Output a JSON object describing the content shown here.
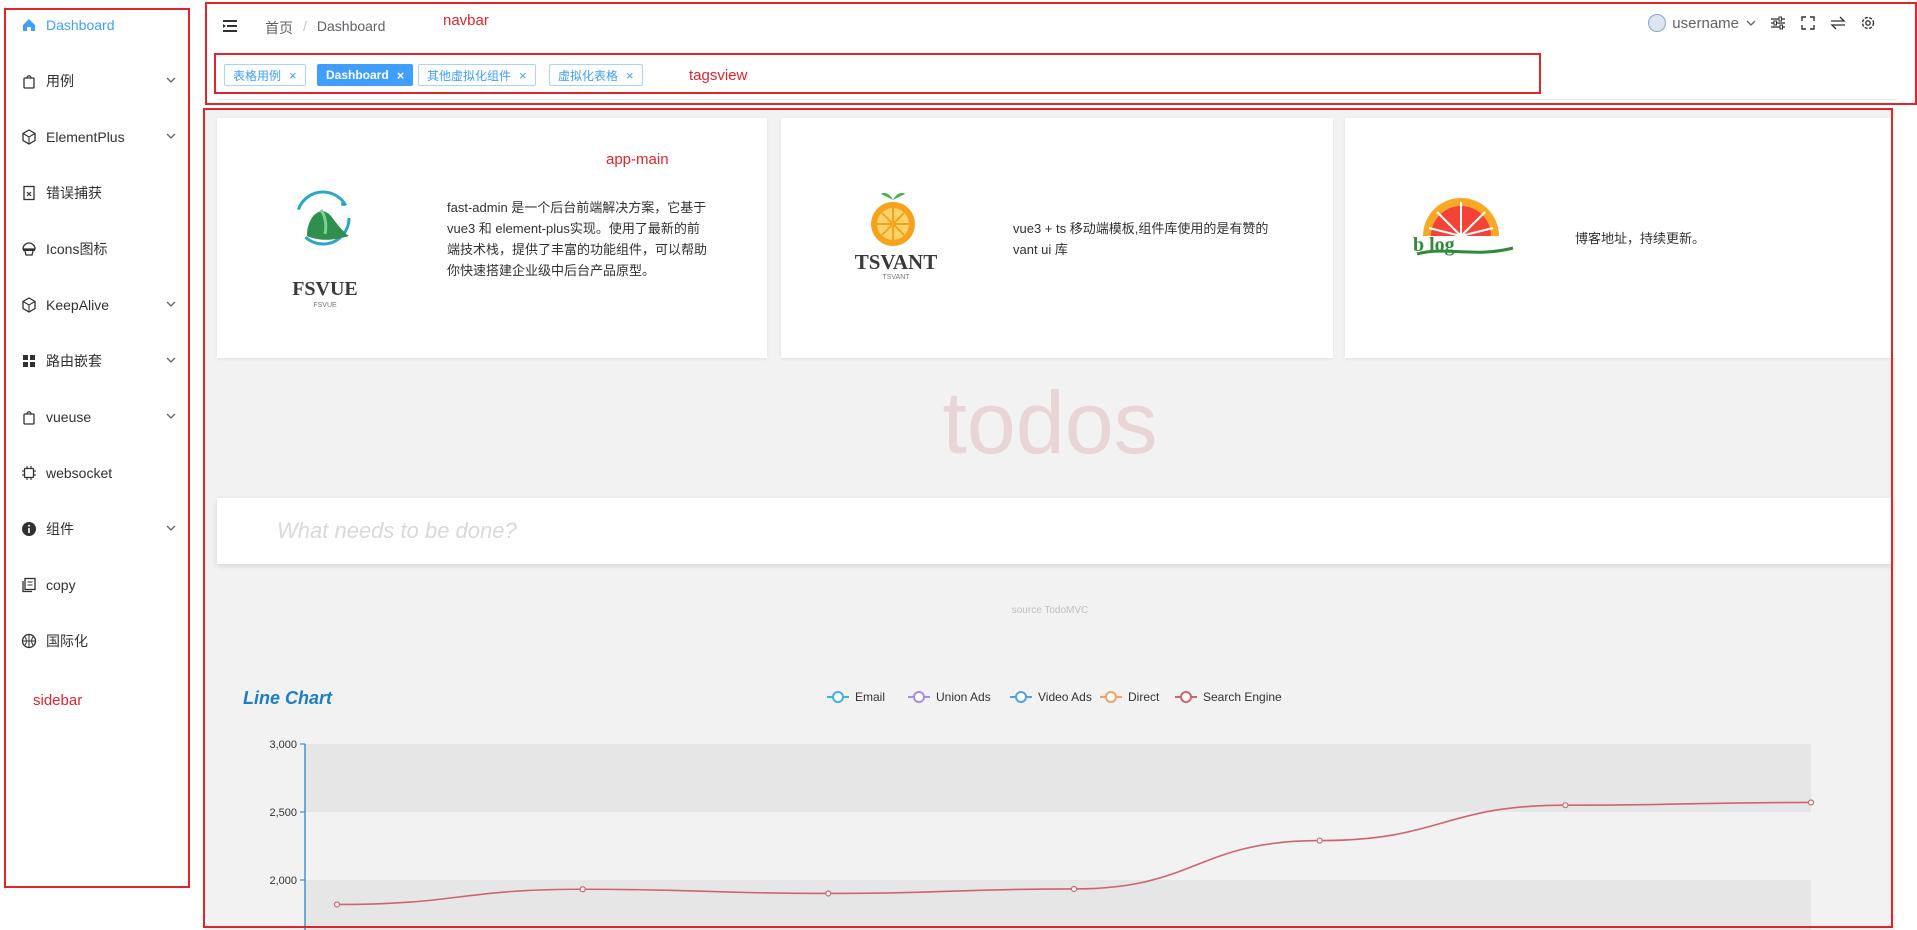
{
  "annotations": {
    "sidebar": "sidebar",
    "navbar": "navbar",
    "tagsview": "tagsview",
    "app_main": "app-main"
  },
  "sidebar": {
    "items": [
      {
        "label": "Dashboard",
        "icon": "home-icon",
        "active": true,
        "arrow": false
      },
      {
        "label": "用例",
        "icon": "bag-icon",
        "active": false,
        "arrow": true
      },
      {
        "label": "ElementPlus",
        "icon": "cube-icon",
        "active": false,
        "arrow": true
      },
      {
        "label": "错误捕获",
        "icon": "error-doc-icon",
        "active": false,
        "arrow": false
      },
      {
        "label": "Icons图标",
        "icon": "bowl-icon",
        "active": false,
        "arrow": false
      },
      {
        "label": "KeepAlive",
        "icon": "cube-icon",
        "active": false,
        "arrow": true
      },
      {
        "label": "路由嵌套",
        "icon": "grid-icon",
        "active": false,
        "arrow": true
      },
      {
        "label": "vueuse",
        "icon": "bag-icon",
        "active": false,
        "arrow": true
      },
      {
        "label": "websocket",
        "icon": "cpu-icon",
        "active": false,
        "arrow": false
      },
      {
        "label": "组件",
        "icon": "info-icon",
        "active": false,
        "arrow": true
      },
      {
        "label": "copy",
        "icon": "copy-icon",
        "active": false,
        "arrow": false
      },
      {
        "label": "国际化",
        "icon": "basketball-icon",
        "active": false,
        "arrow": false
      }
    ]
  },
  "navbar": {
    "breadcrumb": [
      "首页",
      "Dashboard"
    ],
    "username": "username"
  },
  "tags": [
    {
      "label": "表格用例",
      "active": false
    },
    {
      "label": "Dashboard",
      "active": true
    },
    {
      "label": "其他虚拟化组件",
      "active": false
    },
    {
      "label": "虚拟化表格",
      "active": false
    }
  ],
  "cards": [
    {
      "logo_text": "FSVUE",
      "logo_sub": "FSVUE",
      "description_lines": [
        "fast-admin 是一个后台前端解决方案，它基于",
        "vue3 和 element-plus实现。使用了最新的前",
        "端技术栈，提供了丰富的功能组件，可以帮助",
        "你快速搭建企业级中后台产品原型。"
      ]
    },
    {
      "logo_text": "TSVANT",
      "logo_sub": "TSVANT",
      "description_lines": [
        "vue3 + ts 移动端模板,组件库使用的是有赞的",
        "vant ui 库"
      ]
    },
    {
      "logo_text": "b log",
      "description_lines": [
        "博客地址，持续更新。"
      ]
    }
  ],
  "todos": {
    "title": "todos",
    "placeholder": "What needs to be done?",
    "source": "source TodoMVC"
  },
  "colors": {
    "accent": "#409eff",
    "annotation_red": "#e0242c",
    "chart_title": "#1b7ec7"
  },
  "chart_data": {
    "type": "line",
    "title": "Line Chart",
    "series": [
      {
        "name": "Email",
        "color": "#3fb1e3",
        "values": []
      },
      {
        "name": "Union Ads",
        "color": "#a28ee8",
        "values": []
      },
      {
        "name": "Video Ads",
        "color": "#4ea2e6",
        "values": []
      },
      {
        "name": "Direct",
        "color": "#f6a164",
        "values": []
      },
      {
        "name": "Search Engine",
        "color": "#d0646c",
        "values": [
          1820,
          1932,
          1901,
          1934,
          2290,
          2550,
          2570
        ]
      }
    ],
    "yticks": [
      "3,000",
      "2,500",
      "2,000"
    ],
    "ylim": [
      1800,
      3000
    ],
    "legend_position": "top-center",
    "grid": true
  }
}
